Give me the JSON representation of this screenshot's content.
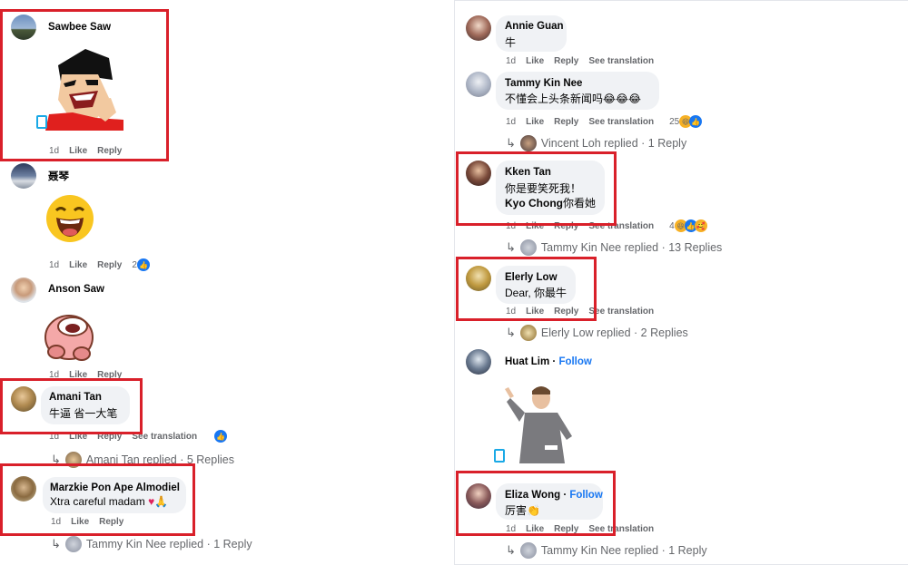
{
  "colors": {
    "highlight_border": "#d9202a",
    "link_blue": "#1877f2",
    "meta_gray": "#65676b",
    "bubble_bg": "#f0f2f5"
  },
  "left": {
    "c1": {
      "name": "Sawbee Saw",
      "time": "1d",
      "like": "Like",
      "reply": "Reply",
      "sticker": "laughing-boy-sticker"
    },
    "c2": {
      "name": "聂琴",
      "time": "1d",
      "like": "Like",
      "reply": "Reply",
      "count": "2",
      "sticker": "laughing-emoji-sticker"
    },
    "c3": {
      "name": "Anson Saw",
      "time": "1d",
      "like": "Like",
      "reply": "Reply",
      "sticker": "pink-character-sticker"
    },
    "c4": {
      "name": "Amani Tan",
      "text": "牛逼 省一大笔",
      "time": "1d",
      "like": "Like",
      "reply": "Reply",
      "translation": "See translation",
      "replied": "Amani Tan replied · 5 Replies"
    },
    "c5": {
      "name": "Marzkie Pon Ape Almodiel",
      "text": "Xtra careful madam",
      "text_emoji": "♥🙏",
      "time": "1d",
      "like": "Like",
      "reply": "Reply",
      "replied": "Tammy Kin Nee replied · 1 Reply"
    }
  },
  "right": {
    "c1": {
      "name": "Annie Guan",
      "text": "牛",
      "time": "1d",
      "like": "Like",
      "reply": "Reply",
      "translation": "See translation"
    },
    "c2": {
      "name": "Tammy Kin Nee",
      "text": "不懂会上头条新闻吗",
      "text_emoji": "😂😂😂",
      "time": "1d",
      "like": "Like",
      "reply": "Reply",
      "translation": "See translation",
      "count": "25",
      "replied": "Vincent Loh replied · 1 Reply"
    },
    "c3": {
      "name": "Kken Tan",
      "text1": "你是要笑死我！",
      "mention": "Kyo Chong",
      "text2": "你看她",
      "time": "1d",
      "like": "Like",
      "reply": "Reply",
      "translation": "See translation",
      "count": "4",
      "replied": "Tammy Kin Nee replied · 13 Replies"
    },
    "c4": {
      "name": "Elerly Low",
      "text": "Dear, 你最牛",
      "time": "1d",
      "like": "Like",
      "reply": "Reply",
      "translation": "See translation",
      "replied": "Elerly Low replied · 2 Replies"
    },
    "c5": {
      "name": "Huat Lim",
      "follow": "Follow",
      "sticker": "man-pointing-gif"
    },
    "c6": {
      "name": "Eliza Wong",
      "follow": "Follow",
      "text": "厉害",
      "text_emoji": "👏",
      "time": "1d",
      "like": "Like",
      "reply": "Reply",
      "translation": "See translation",
      "replied": "Tammy Kin Nee replied · 1 Reply"
    }
  }
}
